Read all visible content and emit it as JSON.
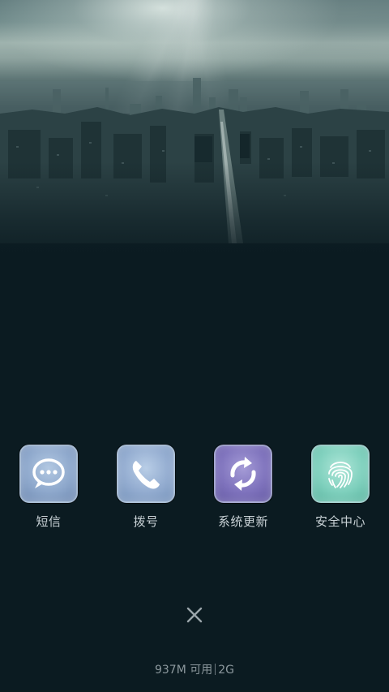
{
  "shortcuts": [
    {
      "label": "短信",
      "icon": "chat-bubble-icon"
    },
    {
      "label": "拨号",
      "icon": "phone-handset-icon"
    },
    {
      "label": "系统更新",
      "icon": "refresh-arrows-icon"
    },
    {
      "label": "安全中心",
      "icon": "fingerprint-icon"
    }
  ],
  "close": {
    "icon": "close-icon"
  },
  "status": {
    "memory": "937M 可用",
    "network": "2G"
  },
  "colors": {
    "background": "#0b1b21",
    "label_text": "#c9d2d6",
    "status_text": "#8c989d"
  }
}
